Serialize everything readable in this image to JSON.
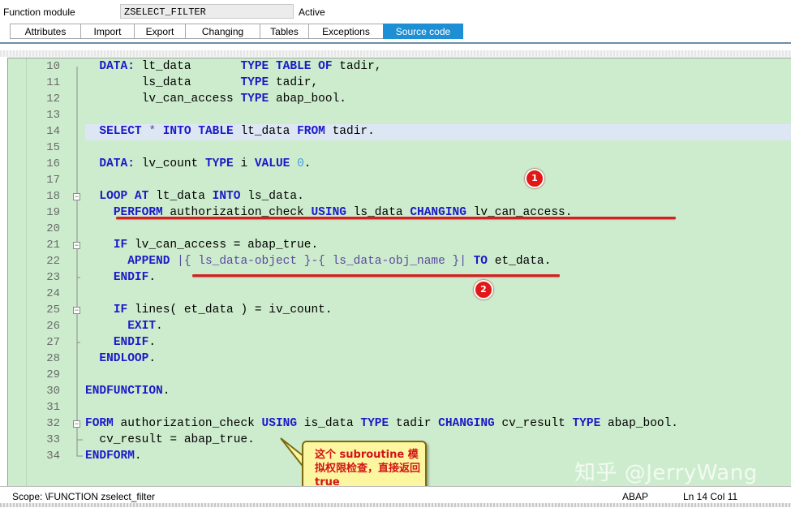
{
  "header": {
    "label": "Function module",
    "name": "ZSELECT_FILTER",
    "status": "Active"
  },
  "tabs": [
    {
      "label": "Attributes",
      "active": false
    },
    {
      "label": "Import",
      "active": false
    },
    {
      "label": "Export",
      "active": false
    },
    {
      "label": "Changing",
      "active": false
    },
    {
      "label": "Tables",
      "active": false
    },
    {
      "label": "Exceptions",
      "active": false
    },
    {
      "label": "Source code",
      "active": true
    }
  ],
  "editor": {
    "current_line": "14",
    "lines": [
      {
        "no": "10",
        "fold": false,
        "tokens": [
          [
            "",
            "  "
          ],
          [
            "kw",
            "DATA:"
          ],
          [
            "",
            " lt_data       "
          ],
          [
            "kw",
            "TYPE TABLE OF"
          ],
          [
            "",
            " tadir,"
          ]
        ]
      },
      {
        "no": "11",
        "fold": false,
        "tokens": [
          [
            "",
            "        ls_data       "
          ],
          [
            "kw",
            "TYPE"
          ],
          [
            "",
            " tadir,"
          ]
        ]
      },
      {
        "no": "12",
        "fold": false,
        "tokens": [
          [
            "",
            "        lv_can_access "
          ],
          [
            "kw",
            "TYPE"
          ],
          [
            "",
            " abap_bool."
          ]
        ]
      },
      {
        "no": "13",
        "fold": false,
        "tokens": []
      },
      {
        "no": "14",
        "fold": false,
        "tokens": [
          [
            "",
            "  "
          ],
          [
            "kw",
            "SELECT"
          ],
          [
            "str",
            " *"
          ],
          [
            "",
            " "
          ],
          [
            "kw",
            "INTO TABLE"
          ],
          [
            "",
            " lt_data "
          ],
          [
            "kw",
            "FROM"
          ],
          [
            "",
            " tadir."
          ]
        ]
      },
      {
        "no": "15",
        "fold": false,
        "tokens": []
      },
      {
        "no": "16",
        "fold": false,
        "tokens": [
          [
            "",
            "  "
          ],
          [
            "kw",
            "DATA:"
          ],
          [
            "",
            " lv_count "
          ],
          [
            "kw",
            "TYPE"
          ],
          [
            "",
            " i "
          ],
          [
            "kw",
            "VALUE"
          ],
          [
            "",
            " "
          ],
          [
            "num",
            "0"
          ],
          [
            "",
            "."
          ]
        ]
      },
      {
        "no": "17",
        "fold": false,
        "tokens": []
      },
      {
        "no": "18",
        "fold": true,
        "tokens": [
          [
            "",
            "  "
          ],
          [
            "kw",
            "LOOP AT"
          ],
          [
            "",
            " lt_data "
          ],
          [
            "kw",
            "INTO"
          ],
          [
            "",
            " ls_data."
          ]
        ]
      },
      {
        "no": "19",
        "fold": false,
        "tokens": [
          [
            "",
            "    "
          ],
          [
            "kw",
            "PERFORM"
          ],
          [
            "",
            " authorization_check "
          ],
          [
            "kw",
            "USING"
          ],
          [
            "",
            " ls_data "
          ],
          [
            "kw",
            "CHANGING"
          ],
          [
            "",
            " lv_can_access."
          ]
        ]
      },
      {
        "no": "20",
        "fold": false,
        "tokens": []
      },
      {
        "no": "21",
        "fold": true,
        "tokens": [
          [
            "",
            "    "
          ],
          [
            "kw",
            "IF"
          ],
          [
            "",
            " lv_can_access = abap_true."
          ]
        ]
      },
      {
        "no": "22",
        "fold": false,
        "tokens": [
          [
            "",
            "      "
          ],
          [
            "kw",
            "APPEND"
          ],
          [
            "str",
            " |{ ls_data-object }-{ ls_data-obj_name }|"
          ],
          [
            "",
            " "
          ],
          [
            "kw",
            "TO"
          ],
          [
            "",
            " et_data."
          ]
        ]
      },
      {
        "no": "23",
        "fold": false,
        "tokens": [
          [
            "",
            "    "
          ],
          [
            "kw",
            "ENDIF"
          ],
          [
            "",
            "."
          ]
        ]
      },
      {
        "no": "24",
        "fold": false,
        "tokens": []
      },
      {
        "no": "25",
        "fold": true,
        "tokens": [
          [
            "",
            "    "
          ],
          [
            "kw",
            "IF"
          ],
          [
            "",
            " lines( et_data ) = iv_count."
          ]
        ]
      },
      {
        "no": "26",
        "fold": false,
        "tokens": [
          [
            "",
            "      "
          ],
          [
            "kw",
            "EXIT"
          ],
          [
            "",
            "."
          ]
        ]
      },
      {
        "no": "27",
        "fold": false,
        "tokens": [
          [
            "",
            "    "
          ],
          [
            "kw",
            "ENDIF"
          ],
          [
            "",
            "."
          ]
        ]
      },
      {
        "no": "28",
        "fold": false,
        "tokens": [
          [
            "",
            "  "
          ],
          [
            "kw",
            "ENDLOOP"
          ],
          [
            "",
            "."
          ]
        ]
      },
      {
        "no": "29",
        "fold": false,
        "tokens": []
      },
      {
        "no": "30",
        "fold": false,
        "tokens": [
          [
            "kw",
            "ENDFUNCTION"
          ],
          [
            "",
            "."
          ]
        ]
      },
      {
        "no": "31",
        "fold": false,
        "tokens": []
      },
      {
        "no": "32",
        "fold": true,
        "tokens": [
          [
            "kw",
            "FORM"
          ],
          [
            "",
            " authorization_check "
          ],
          [
            "kw",
            "USING"
          ],
          [
            "",
            " is_data "
          ],
          [
            "kw",
            "TYPE"
          ],
          [
            "",
            " tadir "
          ],
          [
            "kw",
            "CHANGING"
          ],
          [
            "",
            " cv_result "
          ],
          [
            "kw",
            "TYPE"
          ],
          [
            "",
            " abap_bool."
          ]
        ]
      },
      {
        "no": "33",
        "fold": false,
        "tokens": [
          [
            "",
            "  cv_result = abap_true."
          ]
        ]
      },
      {
        "no": "34",
        "fold": false,
        "tokens": [
          [
            "kw",
            "ENDFORM"
          ],
          [
            "",
            "."
          ]
        ]
      }
    ]
  },
  "annotations": {
    "badge1": "1",
    "badge2": "2",
    "callout_text": "这个 subroutine 模拟权限检查，直接返回 true",
    "color": "#d42020"
  },
  "watermark": "知乎 @JerryWang",
  "statusbar": {
    "scope": "Scope: \\FUNCTION zselect_filter",
    "language": "ABAP",
    "position": "Ln  14 Col  11"
  }
}
